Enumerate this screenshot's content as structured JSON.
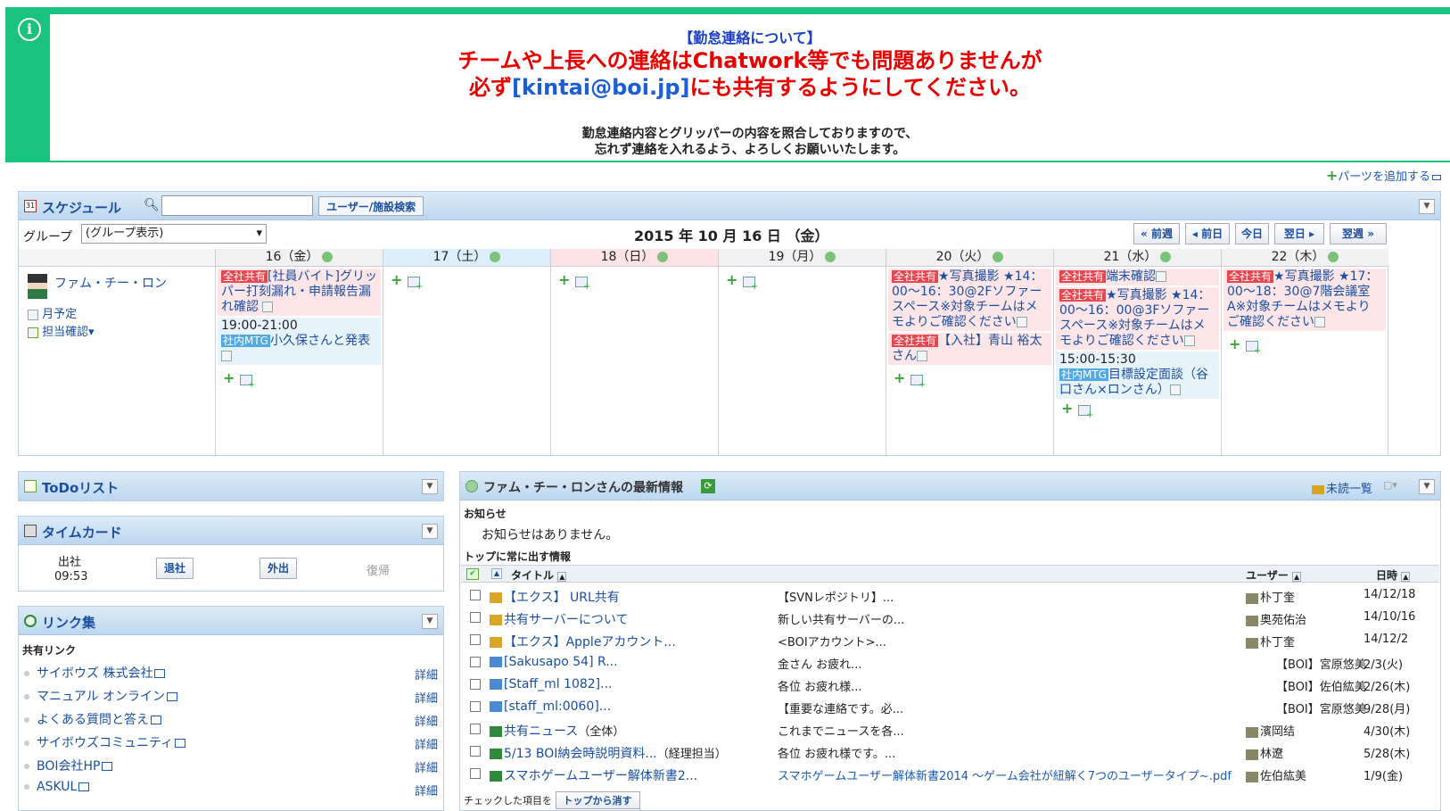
{
  "banner": {
    "heading": "【勤怠連絡について】",
    "line1": "チームや上長への連絡はChatwork等でも問題ありませんが",
    "line2_pre": "必ず",
    "line2_email": "[kintai@boi.jp]",
    "line2_post": "にも共有するようにしてください。",
    "note1": "勤怠連絡内容とグリッパーの内容を照合しておりますので、",
    "note2": "忘れず連絡を入れるよう、よろしくお願いいたします。"
  },
  "add_parts": "パーツを追加する",
  "schedule": {
    "title": "スケジュール",
    "search_value": "",
    "user_search_btn": "ユーザー/施設検索",
    "group_label": "グループ",
    "group_select": "(グループ表示)",
    "current_date": "2015 年 10 月 16 日 （金）",
    "nav": {
      "prev_week": "« 前週",
      "prev_day": "◂ 前日",
      "today": "今日",
      "next_day": "翌日 ▸",
      "next_week": "翌週 »"
    },
    "user": {
      "name": "ファム・チー・ロン",
      "monthly": "月予定",
      "assign": "担当確認"
    },
    "days": [
      {
        "label": "16（金）",
        "color": "#f1f1f1"
      },
      {
        "label": "17（土）",
        "color": "#dbeefc"
      },
      {
        "label": "18（日）",
        "color": "#fde3e6"
      },
      {
        "label": "19（月）",
        "color": "#f1f1f1"
      },
      {
        "label": "20（火）",
        "color": "#f1f1f1"
      },
      {
        "label": "21（水）",
        "color": "#f1f1f1"
      },
      {
        "label": "22（木）",
        "color": "#f1f1f1"
      }
    ],
    "events": {
      "d16a_tag": "全社共有",
      "d16a_text": "[社員バイト]グリッパー打刻漏れ・申請報告漏れ確認",
      "d16b_time": "19:00-21:00",
      "d16b_tag": "社内MTG",
      "d16b_text": "小久保さんと発表",
      "d20a_tag": "全社共有",
      "d20a_text": "★写真撮影 ★14：00〜16：30@2Fソファースペース※対象チームはメモよりご確認ください",
      "d20b_tag": "全社共有",
      "d20b_text": "【入社】青山 裕太さん",
      "d21a_tag": "全社共有",
      "d21a_text": "端末確認",
      "d21b_tag": "全社共有",
      "d21b_text": "★写真撮影 ★14：00〜16：00@3Fソファースペース※対象チームはメモよりご確認ください",
      "d21c_time": "15:00-15:30",
      "d21c_tag": "社内MTG",
      "d21c_text": "目標設定面談（谷口さん×ロンさん）",
      "d22a_tag": "全社共有",
      "d22a_text": "★写真撮影 ★17：00〜18：30@7階会議室A※対象チームはメモよりご確認ください"
    }
  },
  "todo": {
    "title": "ToDoリスト"
  },
  "timecard": {
    "title": "タイムカード",
    "in_label": "出社",
    "in_time": "09:53",
    "leave_btn": "退社",
    "out_btn": "外出",
    "return_label": "復帰"
  },
  "links": {
    "title": "リンク集",
    "section": "共有リンク",
    "detail": "詳細",
    "items": [
      "サイボウズ 株式会社",
      "マニュアル オンライン",
      "よくある質問と答え",
      "サイボウズコミュニティ",
      "BOI会社HP",
      "ASKUL"
    ]
  },
  "news": {
    "title": "ファム・チー・ロンさんの最新情報",
    "unread": "未読一覧",
    "notice_label": "お知らせ",
    "notice_empty": "お知らせはありません。",
    "top_label": "トップに常に出す情報",
    "col_title": "タイトル",
    "col_user": "ユーザー",
    "col_date": "日時",
    "rows": [
      {
        "title": "【エクス】 URL共有",
        "summary": "【SVNレポジトリ】...",
        "user": "朴丁奎",
        "date": "14/12/18"
      },
      {
        "title": "共有サーバーについて",
        "summary": "新しい共有サーバーの...",
        "user": "奥苑佑治",
        "date": "14/10/16"
      },
      {
        "title": "【エクス】Appleアカウント...",
        "summary": "<BOIアカウント>...",
        "user": "朴丁奎",
        "date": "14/12/2"
      },
      {
        "title": "[Sakusapo 54] R...",
        "summary": "金さん お疲れ...",
        "user": "【BOI】宮原悠美",
        "date": "2/3(火)"
      },
      {
        "title": "[Staff_ml 1082]...",
        "summary": "各位 お疲れ様...",
        "user": "【BOI】佐伯紘美",
        "date": "2/26(木)"
      },
      {
        "title": "[staff_ml:0060]...",
        "summary": "【重要な連絡です。必...",
        "user": "【BOI】宮原悠美",
        "date": "9/28(月)"
      },
      {
        "title": "共有ニュース",
        "title_extra": "（全体）",
        "summary": "これまでニュースを各...",
        "user": "濱岡结",
        "date": "4/30(木)"
      },
      {
        "title": "5/13 BOI納会時説明資料...",
        "title_extra": "（経理担当）",
        "summary": "各位 お疲れ様です。...",
        "user": "林遼",
        "date": "5/28(木)"
      },
      {
        "title": "スマホゲームユーザー解体新書2...",
        "summary": "スマホゲームユーザー解体新書2014 ～ゲーム会社が紐解く7つのユーザータイプ~.pdf",
        "user": "佐伯紘美",
        "date": "1/9(金)"
      }
    ],
    "footer_label": "チェックした項目を",
    "footer_btn": "トップから消す"
  }
}
